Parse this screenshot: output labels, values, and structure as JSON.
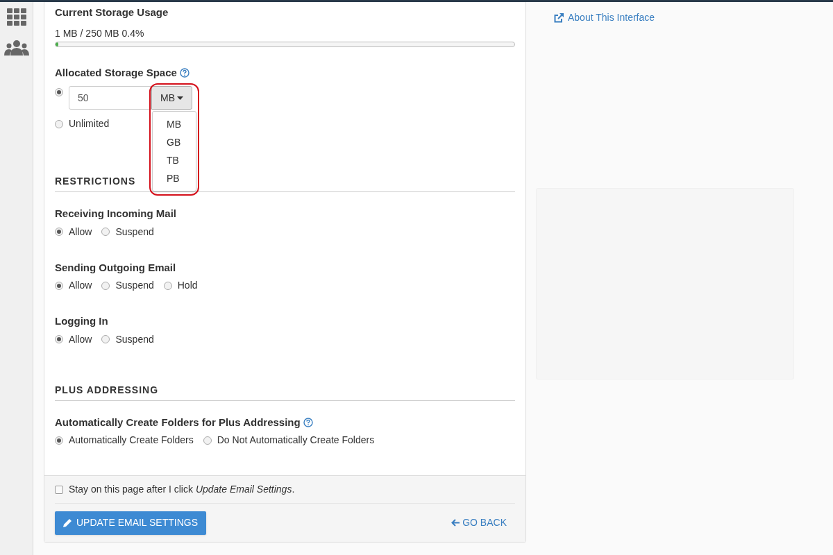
{
  "storage_usage": {
    "label": "Current Storage Usage",
    "reading": "1 MB / 250 MB 0.4%",
    "level": 0.004
  },
  "allocated_storage": {
    "label": "Allocated Storage Space",
    "options": [
      {
        "kind": "amount",
        "value": "50",
        "selected": true
      },
      {
        "kind": "unlimited",
        "label": "Unlimited",
        "selected": false
      }
    ],
    "unit": "MB",
    "unit_menu": [
      "MB",
      "GB",
      "TB",
      "PB"
    ]
  },
  "sections": [
    {
      "heading": "RESTRICTIONS",
      "groups": [
        {
          "label": "Receiving Incoming Mail",
          "help": false,
          "options": [
            {
              "label": "Allow",
              "selected": true
            },
            {
              "label": "Suspend",
              "selected": false
            }
          ]
        },
        {
          "label": "Sending Outgoing Email",
          "help": false,
          "options": [
            {
              "label": "Allow",
              "selected": true
            },
            {
              "label": "Suspend",
              "selected": false
            },
            {
              "label": "Hold",
              "selected": false
            }
          ]
        },
        {
          "label": "Logging In",
          "help": false,
          "options": [
            {
              "label": "Allow",
              "selected": true
            },
            {
              "label": "Suspend",
              "selected": false
            }
          ]
        }
      ]
    },
    {
      "heading": "PLUS ADDRESSING",
      "groups": [
        {
          "label": "Automatically Create Folders for Plus Addressing",
          "help": true,
          "options": [
            {
              "label": "Automatically Create Folders",
              "selected": true
            },
            {
              "label": "Do Not Automatically Create Folders",
              "selected": false
            }
          ]
        }
      ]
    }
  ],
  "stay_checkbox": {
    "label": "Stay on this page after I click *Update Email Settings*.",
    "checked": false
  },
  "update_button": "UPDATE EMAIL SETTINGS",
  "go_back": "GO BACK",
  "about_link": "About This Interface"
}
